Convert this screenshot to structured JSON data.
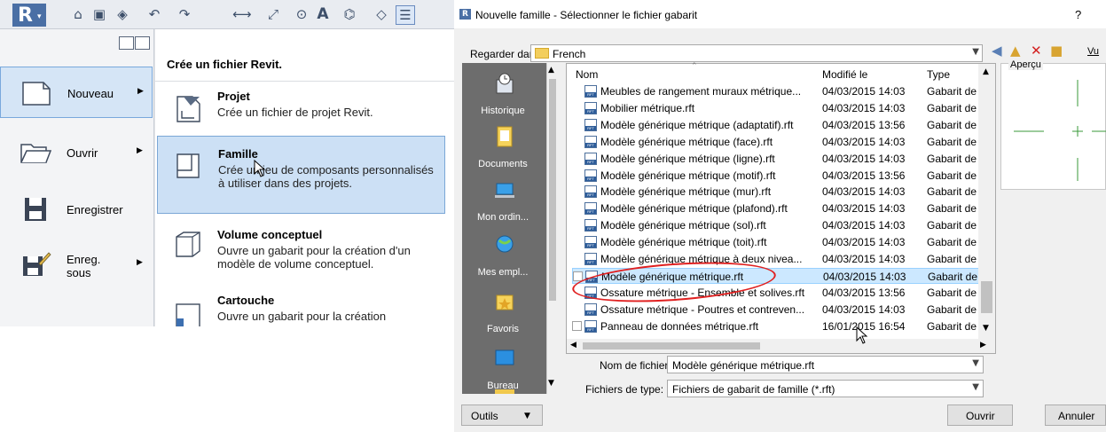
{
  "revit_menu": {
    "header": "Crée un fichier Revit.",
    "left_items": [
      {
        "label": "Nouveau",
        "icon": "new-file-icon"
      },
      {
        "label": "Ouvrir",
        "icon": "open-folder-icon"
      },
      {
        "label": "Enregistrer",
        "icon": "save-disk-icon"
      },
      {
        "label_line1": "Enreg.",
        "label_line2": "sous",
        "icon": "save-as-icon"
      }
    ],
    "sub_items": [
      {
        "title": "Projet",
        "desc": "Crée un fichier de projet Revit.",
        "icon": "project-icon"
      },
      {
        "title": "Famille",
        "desc": "Crée un jeu de composants personnalisés à utiliser dans des projets.",
        "icon": "family-icon"
      },
      {
        "title": "Volume conceptuel",
        "desc": "Ouvre un gabarit pour la création d'un modèle de volume conceptuel.",
        "icon": "conceptual-mass-icon"
      },
      {
        "title": "Cartouche",
        "desc": "Ouvre un gabarit pour la création",
        "icon": "title-block-icon"
      }
    ]
  },
  "dialog": {
    "title": "Nouvelle famille - Sélectionner le fichier gabarit",
    "help": "?",
    "look_in_label": "Regarder dans:",
    "look_in_value": "French",
    "preview_label": "Aperçu",
    "toolbar_extra": "Vu",
    "places": [
      "Historique",
      "Documents",
      "Mon ordin...",
      "Mes empl...",
      "Favoris",
      "Bureau"
    ],
    "columns": {
      "name": "Nom",
      "modified": "Modifié le",
      "type": "Type"
    },
    "files": [
      {
        "name": "Meubles de rangement muraux métrique...",
        "modified": "04/03/2015 14:03",
        "type": "Gabarit de"
      },
      {
        "name": "Mobilier métrique.rft",
        "modified": "04/03/2015 14:03",
        "type": "Gabarit de"
      },
      {
        "name": "Modèle générique métrique (adaptatif).rft",
        "modified": "04/03/2015 13:56",
        "type": "Gabarit de"
      },
      {
        "name": "Modèle générique métrique (face).rft",
        "modified": "04/03/2015 14:03",
        "type": "Gabarit de"
      },
      {
        "name": "Modèle générique métrique (ligne).rft",
        "modified": "04/03/2015 14:03",
        "type": "Gabarit de"
      },
      {
        "name": "Modèle générique métrique (motif).rft",
        "modified": "04/03/2015 13:56",
        "type": "Gabarit de"
      },
      {
        "name": "Modèle générique métrique (mur).rft",
        "modified": "04/03/2015 14:03",
        "type": "Gabarit de"
      },
      {
        "name": "Modèle générique métrique (plafond).rft",
        "modified": "04/03/2015 14:03",
        "type": "Gabarit de"
      },
      {
        "name": "Modèle générique métrique (sol).rft",
        "modified": "04/03/2015 14:03",
        "type": "Gabarit de"
      },
      {
        "name": "Modèle générique métrique (toit).rft",
        "modified": "04/03/2015 14:03",
        "type": "Gabarit de"
      },
      {
        "name": "Modèle générique métrique à deux nivea...",
        "modified": "04/03/2015 14:03",
        "type": "Gabarit de"
      },
      {
        "name": "Modèle générique métrique.rft",
        "modified": "04/03/2015 14:03",
        "type": "Gabarit de",
        "selected": true
      },
      {
        "name": "Ossature métrique - Ensemble et solives.rft",
        "modified": "04/03/2015 13:56",
        "type": "Gabarit de"
      },
      {
        "name": "Ossature métrique - Poutres et contreven...",
        "modified": "04/03/2015 14:03",
        "type": "Gabarit de"
      },
      {
        "name": "Panneau de données métrique.rft",
        "modified": "16/01/2015 16:54",
        "type": "Gabarit de"
      }
    ],
    "filename_label": "Nom de fichier:",
    "filename_value": "Modèle générique métrique.rft",
    "filetype_label": "Fichiers de type:",
    "filetype_value": "Fichiers de gabarit de famille  (*.rft)",
    "tools_label": "Outils",
    "open_label": "Ouvrir",
    "cancel_label": "Annuler",
    "accent_selected": "#cce8ff",
    "highlight_circle": "#e02020"
  }
}
